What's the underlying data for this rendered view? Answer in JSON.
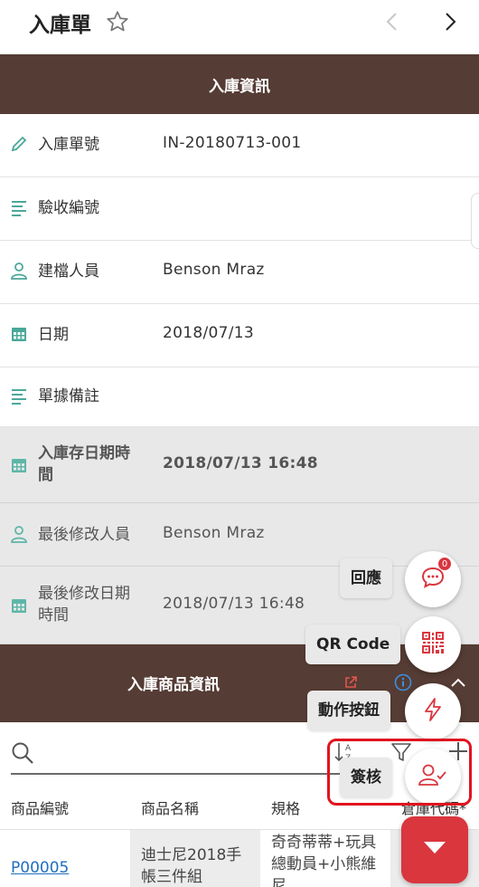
{
  "topbar": {
    "title": "入庫單"
  },
  "info_section": {
    "header": "入庫資訊",
    "fields": [
      {
        "label": "入庫單號",
        "value": "IN-20180713-001",
        "icon": "pencil-icon"
      },
      {
        "label": "驗收編號",
        "value": "",
        "icon": "text-lines-icon"
      },
      {
        "label": "建檔人員",
        "value": "Benson Mraz",
        "icon": "person-icon"
      },
      {
        "label": "日期",
        "value": "2018/07/13",
        "icon": "calendar-icon"
      },
      {
        "label": "單據備註",
        "value": "",
        "icon": "text-lines-icon"
      },
      {
        "label_line1": "入庫存日期時",
        "label_line2": "間",
        "value": "2018/07/13 16:48",
        "icon": "calendar-icon"
      },
      {
        "label": "最後修改人員",
        "value": "Benson Mraz",
        "icon": "person-icon"
      },
      {
        "label_line1": "最後修改日期",
        "label_line2": "時間",
        "value": "2018/07/13 16:48",
        "icon": "calendar-icon"
      }
    ]
  },
  "product_section": {
    "header": "入庫商品資訊",
    "columns": [
      "商品編號",
      "商品名稱",
      "規格",
      "倉庫代碼*"
    ],
    "rows": [
      {
        "code": "P00005",
        "name": "迪士尼2018手帳三件組",
        "spec": "奇奇蒂蒂+玩具總動員+小熊維尼"
      }
    ]
  },
  "fab": {
    "reply_label": "回應",
    "reply_badge": "0",
    "qrcode_label": "QR Code",
    "action_label": "動作按鈕",
    "sign_label": "簽核"
  },
  "colors": {
    "header_brown": "#553c34",
    "accent_red": "#d9363e",
    "icon_teal": "#4aa89a",
    "link_blue": "#1f6fbf"
  }
}
